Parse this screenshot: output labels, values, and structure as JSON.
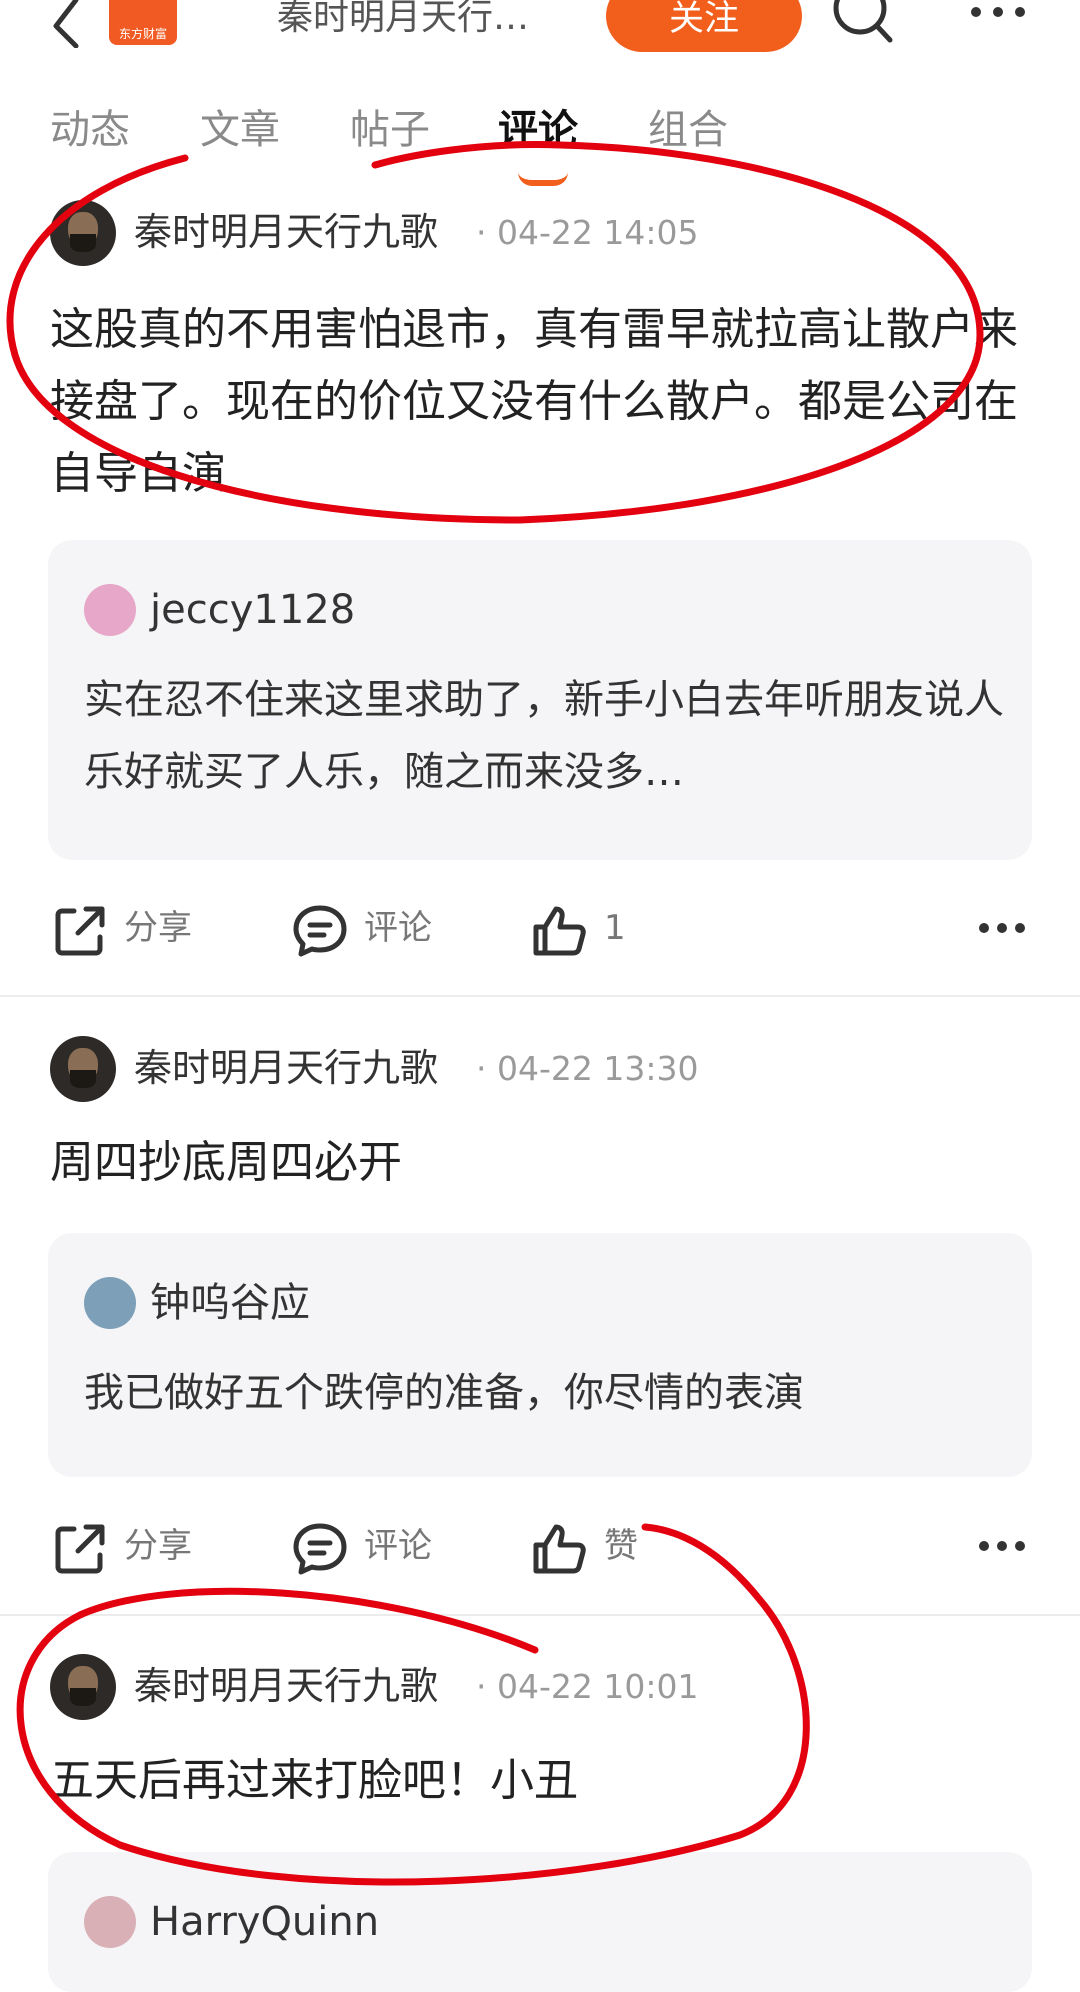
{
  "header": {
    "title": "秦时明月天行…",
    "follow_label": "关注",
    "logo_text": "东方财富"
  },
  "tabs": [
    "动态",
    "文章",
    "帖子",
    "评论",
    "组合"
  ],
  "active_tab": "评论",
  "colors": {
    "accent": "#f25f1c",
    "annotation": "#e3000f"
  },
  "posts": [
    {
      "user": "秦时明月天行九歌",
      "time": "· 04-22 14:05",
      "content": "这股真的不用害怕退市，真有雷早就拉高让散户来接盘了。现在的价位又没有什么散户。都是公司在自导自演",
      "quote": {
        "user": "jeccy1128",
        "text": "实在忍不住来这里求助了，新手小白去年听朋友说人乐好就买了人乐，随之而来没多…"
      },
      "share": "分享",
      "comment": "评论",
      "like": "1"
    },
    {
      "user": "秦时明月天行九歌",
      "time": "· 04-22 13:30",
      "content": "周四抄底周四必开",
      "quote": {
        "user": "钟呜谷应",
        "text": "我已做好五个跌停的准备，你尽情的表演"
      },
      "share": "分享",
      "comment": "评论",
      "like": "赞"
    },
    {
      "user": "秦时明月天行九歌",
      "time": "· 04-22 10:01",
      "content": "五天后再过来打脸吧！小丑",
      "quote": {
        "user": "HarryQuinn"
      }
    }
  ]
}
